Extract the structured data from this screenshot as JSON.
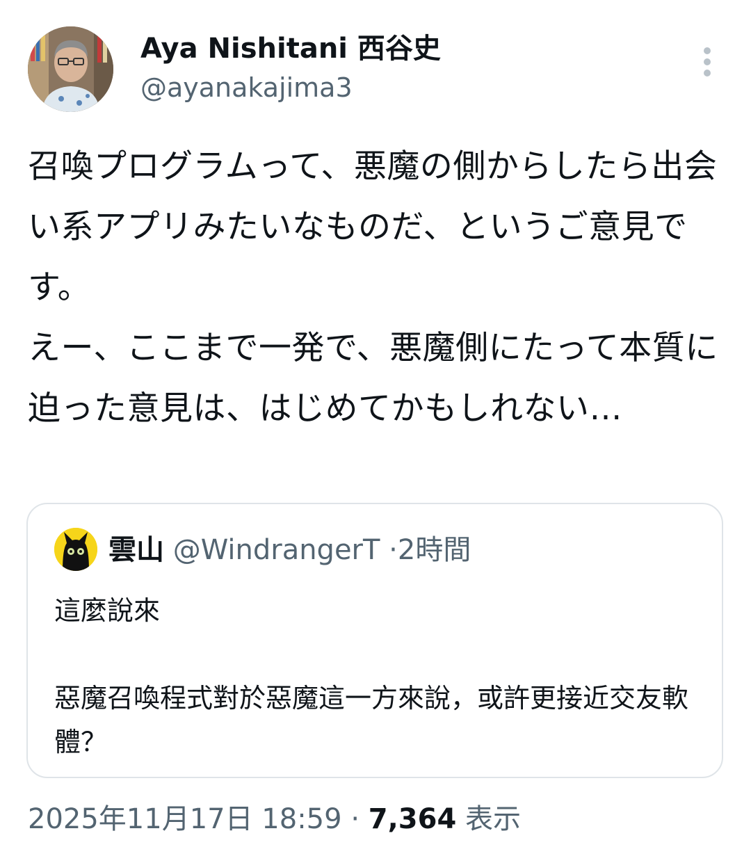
{
  "author": {
    "name": "Aya Nishitani 西谷史",
    "handle": "@ayanakajima3"
  },
  "tweet": {
    "text": "召喚プログラムって、悪魔の側からしたら出会い系アプリみたいなものだ、というご意見です。\nえー、ここまで一発で、悪魔側にたって本質に迫った意見は、はじめてかもしれない…"
  },
  "quoted_tweet": {
    "name": "雲山",
    "handle": "@WindrangerT",
    "separator": "·",
    "time": "2時間",
    "text": "這麼說來\n\n惡魔召喚程式對於惡魔這一方來說，或許更接近交友軟體？"
  },
  "meta": {
    "timestamp": "2025年11月17日 18:59",
    "separator": "·",
    "views_count": "7,364",
    "views_label": "表示"
  },
  "icons": {
    "more": "more-vertical-icon"
  },
  "colors": {
    "text": "#0f1419",
    "secondary_text": "#536471",
    "border": "#dfe4e8",
    "quote_avatar_bg": "#f6d51a"
  }
}
